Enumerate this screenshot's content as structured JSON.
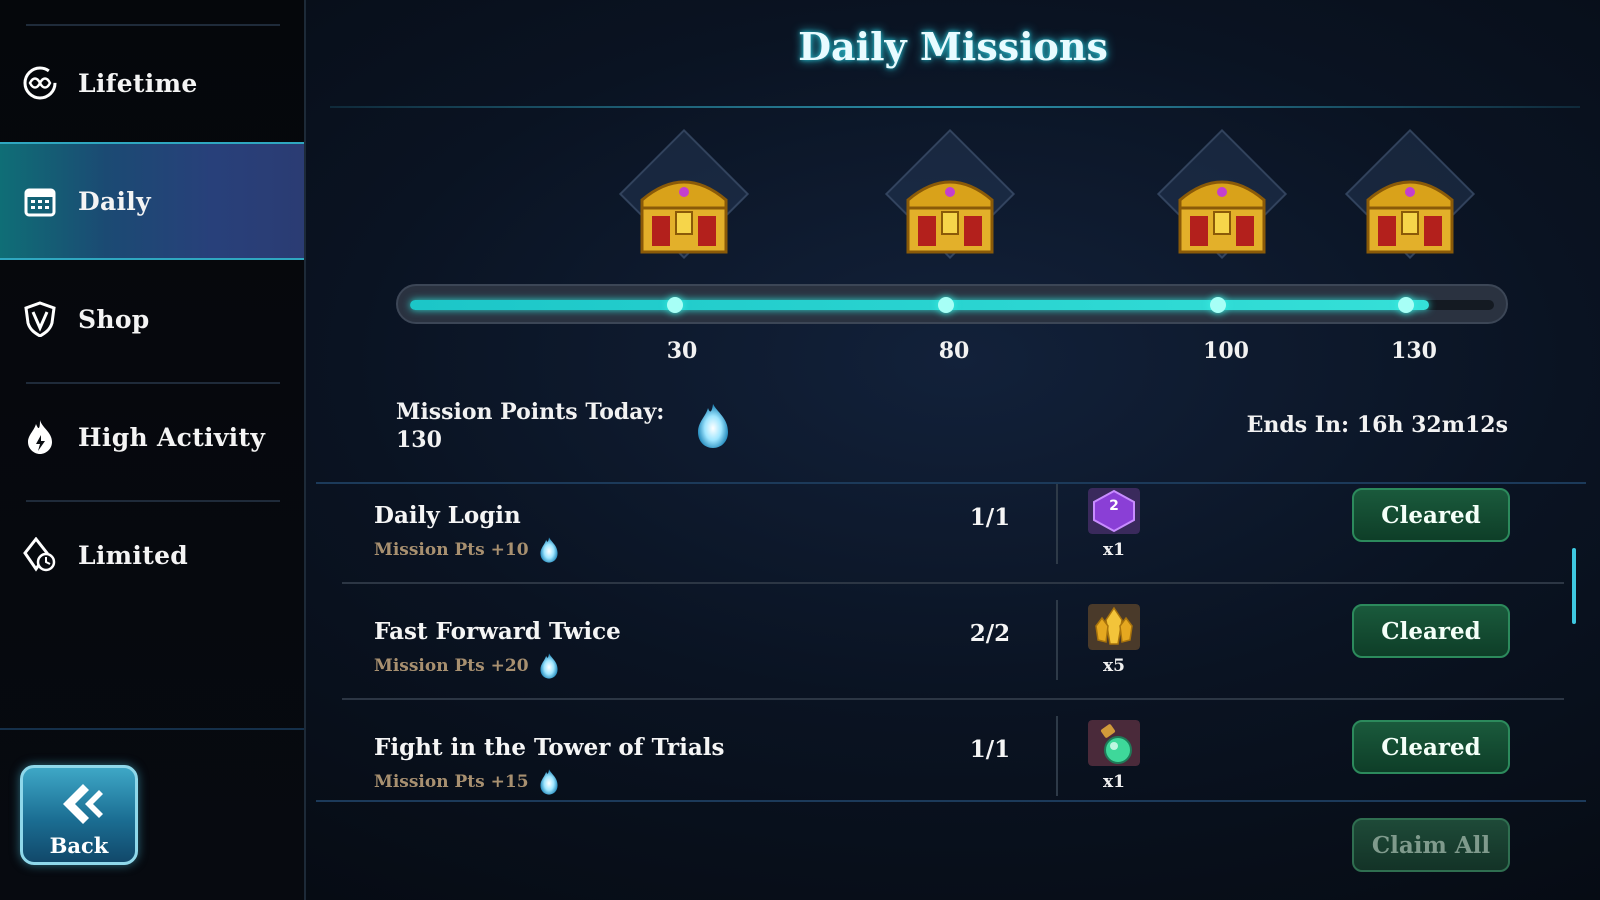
{
  "sidebar": {
    "items": [
      {
        "label": "Lifetime",
        "icon": "infinity-refresh-icon"
      },
      {
        "label": "Daily",
        "icon": "calendar-icon"
      },
      {
        "label": "Shop",
        "icon": "shield-v-icon"
      },
      {
        "label": "High Activity",
        "icon": "flame-icon"
      },
      {
        "label": "Limited",
        "icon": "diamond-clock-icon"
      }
    ],
    "active_index": 1,
    "back_label": "Back"
  },
  "title": "Daily Missions",
  "progress": {
    "milestones": [
      "30",
      "80",
      "100",
      "130"
    ],
    "max_points": 130,
    "current_points": 130,
    "fill_fraction": 0.94
  },
  "points": {
    "label": "Mission Points Today:",
    "value": "130"
  },
  "ends": "Ends In: 16h 32m12s",
  "missions": [
    {
      "name": "Daily Login",
      "pts": "Mission Pts +10",
      "progress": "1/1",
      "reward": "reward-purple-ticket-icon",
      "qty": "x1",
      "status": "Cleared"
    },
    {
      "name": "Fast Forward Twice",
      "pts": "Mission Pts +20",
      "progress": "2/2",
      "reward": "reward-gold-crystal-icon",
      "qty": "x5",
      "status": "Cleared"
    },
    {
      "name": "Fight in the Tower of Trials",
      "pts": "Mission Pts +15",
      "progress": "1/1",
      "reward": "reward-potion-icon",
      "qty": "x1",
      "status": "Cleared"
    }
  ],
  "claim_all": "Claim All",
  "colors": {
    "accent": "#2ec6d8",
    "active_tab": "#1b4a73",
    "cleared_button": "#1a5a3c"
  }
}
